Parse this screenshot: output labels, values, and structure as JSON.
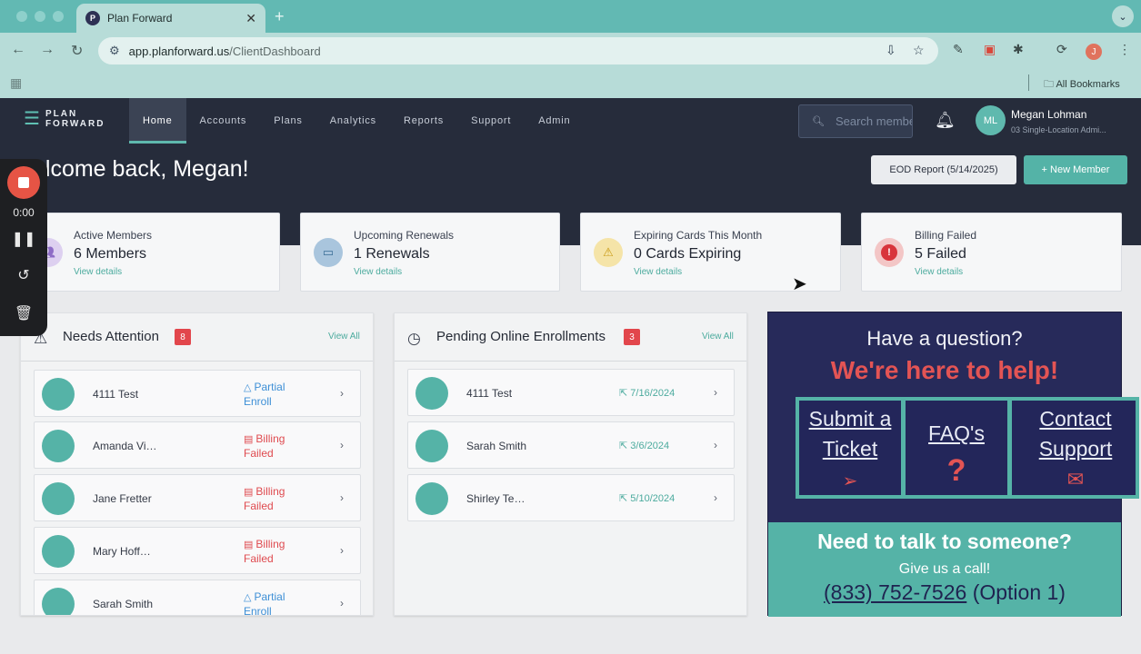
{
  "browser": {
    "tab_title": "Plan Forward",
    "tab_favicon": "P",
    "url_host": "app.planforward.us",
    "url_path": "/ClientDashboard",
    "profile_initial": "J",
    "bookmarks_label": "All Bookmarks"
  },
  "app": {
    "logo_line1": "PLAN",
    "logo_line2": "FORWARD",
    "menu": [
      "Home",
      "Accounts",
      "Plans",
      "Analytics",
      "Reports",
      "Support",
      "Admin"
    ],
    "active_menu": "Home",
    "search_placeholder": "Search members",
    "user_initials": "ML",
    "user_name": "Megan Lohman",
    "user_role": "03 Single-Location Admi..."
  },
  "welcome": {
    "text": "elcome back, Megan!",
    "eod_button": "EOD Report (5/14/2025)",
    "new_member_button": "+ New Member"
  },
  "stats": [
    {
      "label": "Active Members",
      "value": "6 Members",
      "link": "View details",
      "icon": "members-icon",
      "color": "#c7b3e6"
    },
    {
      "label": "Upcoming Renewals",
      "value": "1 Renewals",
      "link": "View details",
      "icon": "card-icon",
      "color": "#a9c5dd"
    },
    {
      "label": "Expiring Cards This Month",
      "value": "0 Cards Expiring",
      "link": "View details",
      "icon": "warning-icon",
      "color": "#f5e4a8"
    },
    {
      "label": "Billing Failed",
      "value": "5 Failed",
      "link": "View details",
      "icon": "alert-icon",
      "color": "#f3c6c6"
    }
  ],
  "needs_attention": {
    "title": "Needs Attention",
    "badge": "8",
    "view_all": "View All",
    "rows": [
      {
        "name": "4111 Test",
        "status1": "Partial",
        "status2": "Enroll",
        "kind": "partial"
      },
      {
        "name": "Amanda Vi…",
        "status1": "Billing",
        "status2": "Failed",
        "kind": "billing"
      },
      {
        "name": "Jane Fretter",
        "status1": "Billing",
        "status2": "Failed",
        "kind": "billing"
      },
      {
        "name": "Mary Hoff…",
        "status1": "Billing",
        "status2": "Failed",
        "kind": "billing"
      },
      {
        "name": "Sarah Smith",
        "status1": "Partial",
        "status2": "Enroll",
        "kind": "partial"
      }
    ]
  },
  "pending": {
    "title": "Pending Online Enrollments",
    "badge": "3",
    "view_all": "View All",
    "rows": [
      {
        "name": "4111 Test",
        "date": "7/16/2024"
      },
      {
        "name": "Sarah Smith",
        "date": "3/6/2024"
      },
      {
        "name": "Shirley Te…",
        "date": "5/10/2024"
      }
    ]
  },
  "help": {
    "question": "Have a question?",
    "headline": "We're here to help!",
    "box1_line1": "Submit a",
    "box1_line2": "Ticket",
    "box2": "FAQ's",
    "box3_line1": "Contact",
    "box3_line2": "Support",
    "footer_title": "Need to talk to someone?",
    "footer_sub": "Give us a call!",
    "phone": "(833) 752-7526",
    "phone_suffix": " (Option 1)"
  },
  "recorder": {
    "time": "0:00"
  }
}
